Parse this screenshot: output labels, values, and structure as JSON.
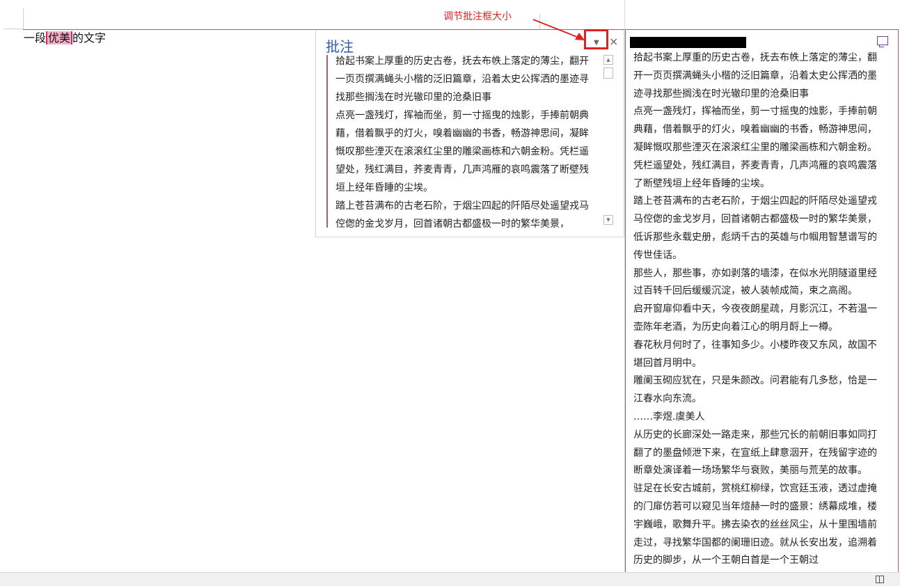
{
  "annotation": {
    "label": "调节批注框大小",
    "color": "#e02020"
  },
  "document": {
    "text_before": "一段",
    "text_highlight": "优美",
    "text_after": "的文字",
    "highlight_color": "#f4b0c8"
  },
  "comment_pane": {
    "title": "批注",
    "dropdown_icon": "triangle-down",
    "close_icon": "close-x",
    "paragraphs": [
      "拾起书案上厚重的历史古卷，抚去布帙上落定的薄尘，翻开一页页撰满蝇头小楷的泛旧篇章，沿着太史公挥洒的墨迹寻找那些搁浅在时光辙印里的沧桑旧事",
      "点亮一盏残灯，挥袖而坐，剪一寸摇曳的烛影，手捧前朝典藉，借着飘乎的灯火，嗅着幽幽的书香，畅游神思间，凝眸慨叹那些湮灭在滚滚红尘里的雕梁画栋和六朝金粉。凭栏遥望处，残红满目，荞麦青青，几声鸿雁的哀鸣震落了断壁残垣上经年昏睡的尘埃。",
      "踏上苍苔满布的古老石阶，于烟尘四起的阡陌尽处遥望戎马倥偬的金戈岁月，回首诸朝古都盛极一时的繁华美景，"
    ]
  },
  "side_panel": {
    "author": "",
    "reply_icon": "reply-comment",
    "paragraphs": [
      "拾起书案上厚重的历史古卷，抚去布帙上落定的薄尘，翻开一页页撰满蝇头小楷的泛旧篇章，沿着太史公挥洒的墨迹寻找那些搁浅在时光辙印里的沧桑旧事",
      "点亮一盏残灯，挥袖而坐，剪一寸摇曳的烛影，手捧前朝典藉，借着飘乎的灯火，嗅着幽幽的书香，畅游神思间，凝眸慨叹那些湮灭在滚滚红尘里的雕梁画栋和六朝金粉。凭栏遥望处，残红满目，荞麦青青，几声鸿雁的哀鸣震落了断壁残垣上经年昏睡的尘埃。",
      "踏上苍苔满布的古老石阶，于烟尘四起的阡陌尽处遥望戎马倥偬的金戈岁月，回首诸朝古都盛极一时的繁华美景，低诉那些永载史册，彪炳千古的英雄与巾帼用智慧谱写的传世佳话。",
      "那些人，那些事，亦如剥落的墙漆，在似水光阴隧道里经过百转千回后缓缓沉淀，被人装帧成简，束之高阁。",
      "启开窗扉仰看中天，今夜夜朗星疏，月影沉江，不若温一壶陈年老酒，为历史向着江心的明月酹上一樽。",
      "春花秋月何时了，往事知多少。小楼昨夜又东风，故国不堪回首月明中。",
      "雕阑玉砌应犹在，只是朱颜改。问君能有几多愁，恰是一江春水向东流。",
      "……李煜.虞美人",
      "从历史的长廊深处一路走来，那些冗长的前朝旧事如同打翻了的墨盘倾泄下来，在宣纸上肆意洇开，在残留字迹的断章处演译着一场场繁华与衰败，美丽与荒芜的故事。",
      "驻足在长安古城前，赏桃红柳绿，饮宫廷玉液，透过虚掩的门扉仿若可以窥见当年煊赫一时的盛景：绣幕成堆，楼宇巍峨，歌舞升平。拂去染衣的丝丝风尘，从十里围墙前走过，寻找繁华国都的阑珊旧迹。就从长安出发，追溯着历史的脚步，从一个王朝白首是一个王朝过"
    ]
  },
  "status_bar": {
    "read_mode_icon": "book-icon"
  }
}
